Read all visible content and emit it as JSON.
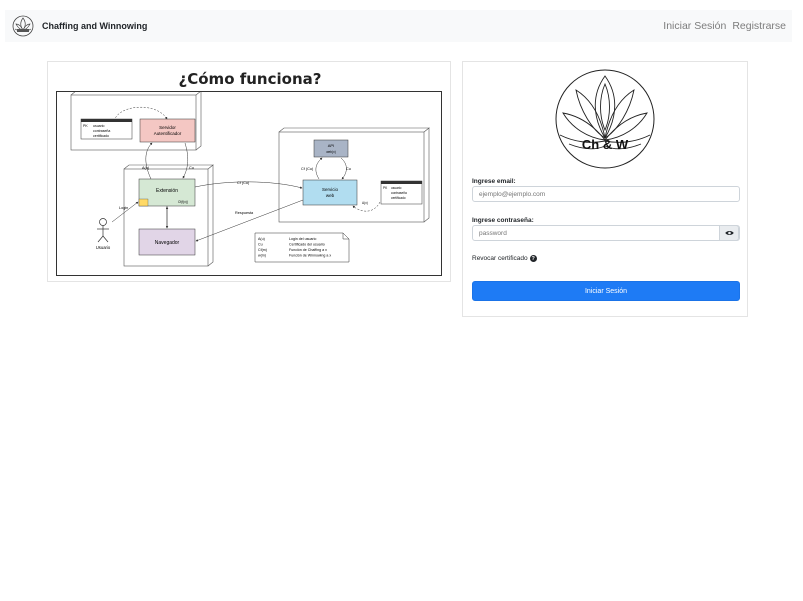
{
  "navbar": {
    "brand": "Chaffing and Winnowing",
    "links": [
      "Iniciar Sesión",
      "Registrarse"
    ]
  },
  "diagram": {
    "title": "¿Cómo funciona?",
    "nodes": {
      "server_auth": [
        "Servidor",
        "Autentificador"
      ],
      "extension": "Extensión",
      "browser": "Navegador",
      "web_service": [
        "Servicio",
        "web"
      ],
      "api": [
        "API",
        "web(x)"
      ],
      "user": "Usuario"
    },
    "edge_labels": {
      "a_u": "A(u)",
      "cu_top": "Cu",
      "login": "Login",
      "cf_cu": "Cf (Cu)",
      "respuesta": "Respuesta",
      "cf_cu_api": "Cf (Cu)",
      "cu_api": "Cu",
      "api_ret": "A(x)",
      "ext_tag": "Cf(f(x))"
    },
    "db_rows": {
      "key": "PK",
      "fields": [
        "usuario",
        "contraseña",
        "certificado"
      ]
    },
    "legend": [
      {
        "key": "A(u)",
        "desc": "Login del usuario"
      },
      {
        "key": "Cu",
        "desc": "Certificado del usuario"
      },
      {
        "key": "Cf(m)",
        "desc": "Función de Chaffing a x"
      },
      {
        "key": "w(m)",
        "desc": "Función de Winnowing a x"
      }
    ]
  },
  "login": {
    "logo_text": "Ch & W",
    "email_label": "Ingrese email:",
    "email_placeholder": "ejemplo@ejemplo.com",
    "password_label": "Ingrese contraseña:",
    "password_placeholder": "password",
    "revoke_label": "Revocar certificado",
    "submit_label": "Iniciar Sesión"
  },
  "colors": {
    "primary": "#1e7bf5",
    "navbar_bg": "#f8f9fa",
    "server_auth": "#f4c7c3",
    "extension": "#d5e8d4",
    "browser": "#e1d5e7",
    "web_service": "#b1ddf0",
    "api": "#a9b4c6"
  },
  "icons": [
    "lotus-logo-icon",
    "eye-icon",
    "question-circle-icon"
  ]
}
